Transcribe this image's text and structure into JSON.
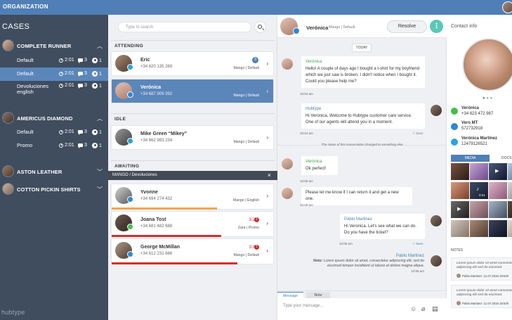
{
  "topbar": {
    "org_label": "ORGANIZATION"
  },
  "cases": {
    "title": "CASES",
    "logo_text": "hubtype",
    "groups": [
      {
        "name": "COMPLETE RUNNER",
        "expanded": true,
        "queues": [
          {
            "name": "Default",
            "time": "2:01",
            "messages": "3",
            "users": "1",
            "selected": false
          },
          {
            "name": "Default",
            "time": "2:01",
            "messages": "3",
            "users": "1",
            "selected": true
          },
          {
            "name": "Devoluciones english",
            "time": "2:01",
            "messages": "3",
            "users": "1",
            "selected": false
          }
        ]
      },
      {
        "name": "AMERICUS DIAMOND",
        "expanded": true,
        "queues": [
          {
            "name": "Default",
            "time": "2:01",
            "messages": "3",
            "users": "1",
            "selected": false
          },
          {
            "name": "Promo",
            "time": "2:01",
            "messages": "3",
            "users": "1",
            "selected": false
          }
        ]
      },
      {
        "name": "ASTON LEATHER",
        "expanded": false
      },
      {
        "name": "COTTON PICKIN SHIRTS",
        "expanded": false
      }
    ]
  },
  "conversations": {
    "search_placeholder": "Type to search",
    "sections": {
      "attending": "ATTENDING",
      "idle": "IDLE",
      "awaiting": "AWAITING"
    },
    "awaiting_filter": "MANGO / Devoluciones",
    "items": [
      {
        "name": "Eric",
        "phone": "+34 620 135 269",
        "queue": "Mango | Default",
        "badge": "3",
        "channel": "telegram"
      },
      {
        "name": "Verónica",
        "phone": "+34 687 909 392",
        "queue": "Mango | Default",
        "channel": "messenger",
        "selected": true
      },
      {
        "name": "Mike Green “Mikey”",
        "phone": "+34 662 983 234",
        "queue": "Mango | Default",
        "channel": "telegram"
      },
      {
        "name": "Yvonne",
        "phone": "+34 694 274 432",
        "queue": "Mango | English",
        "channel": "messenger",
        "progress": 0.65,
        "progress_color": "#f0a64a"
      },
      {
        "name": "Joana Tost",
        "phone": "+34 681 482 688",
        "queue": "Zara | Promo",
        "time": "3:24",
        "channel": "whatsapp",
        "progress": 0.68,
        "progress_color": "#d0312d"
      },
      {
        "name": "George McMillan",
        "phone": "+34 612 231 666",
        "queue": "Mango | Default",
        "time": "3:41",
        "channel": "messenger",
        "progress": 0.78,
        "progress_color": "#d0312d"
      }
    ]
  },
  "chat": {
    "contact_name": "Verónica",
    "queue": "Mango | Default",
    "resolve_label": "Resolve",
    "today_label": "TODAY",
    "messages": [
      {
        "author": "Verónica",
        "text": "Hello! A couple of days ago I bought a t-shirt for my boyfriend which we just saw is broken. I didn't notice when I bought it. Could you please help me?",
        "time": "10:04 am"
      },
      {
        "author": "Hubtype",
        "text": "Hi Veronica, Welcome to Hubtype customer care service. One of our agents will attend you in a moment.",
        "time": "10:04 am",
        "status": "Seen"
      },
      {
        "author": "Verónica",
        "text": "Ok perfect!",
        "time": "10:05 am"
      },
      {
        "text": "Please let me know if I can return it and get a new one.",
        "time": "10:05 am"
      },
      {
        "author": "Pablo Martinez",
        "text": "Hi Veronica. Let's see what we can do. Do you have the ticket?",
        "time": "10:06 am",
        "status": "Seen"
      }
    ],
    "system_event": "The status of this conversation changed to something else",
    "note": {
      "author": "Pablo Martinez",
      "prefix": "Note:",
      "text": "Lorem ipsum dolor sit amet, consectetur adipiscing elit, sed do eiusmod tempor incididunt ut labore et dolore magna aliqua.",
      "time": "10:06 am"
    },
    "tabs": {
      "message": "Message",
      "note": "Note"
    },
    "composer_placeholder": "Type your message..."
  },
  "contact": {
    "title": "Contact info",
    "channels": [
      {
        "name": "Verónica",
        "phone": "+34 623 472 987",
        "channel": "whatsapp",
        "color": "#3fbf4c"
      },
      {
        "name": "Vero MT",
        "phone": "572732918",
        "channel": "messenger",
        "color": "#2f86d6"
      },
      {
        "name": "Verónica Martínez",
        "phone": "12479126521",
        "channel": "telegram",
        "color": "#2aa3dc"
      }
    ],
    "media_tabs": {
      "media": "MEDIA",
      "docs": "DOCS"
    },
    "audio_duration": "0:21",
    "notes_title": "NOTES",
    "notes": [
      {
        "text": "Lorem ipsum dolor sit amet consectetur adipiscing elit sed do eiusmod.",
        "author": "Pablo Martinez",
        "date": "11.07.2016 19:54h"
      },
      {
        "text": "Lorem ipsum dolor sit amet consectetur adipiscing elit sed do eiusmod.",
        "author": "Pablo Martinez",
        "date": "11.07.2016 19:54h"
      }
    ]
  },
  "colors": {
    "brand": "#4f7fb6",
    "sidebar": "#3f4d5e",
    "alert": "#d0312d",
    "accent": "#59c9b6"
  }
}
